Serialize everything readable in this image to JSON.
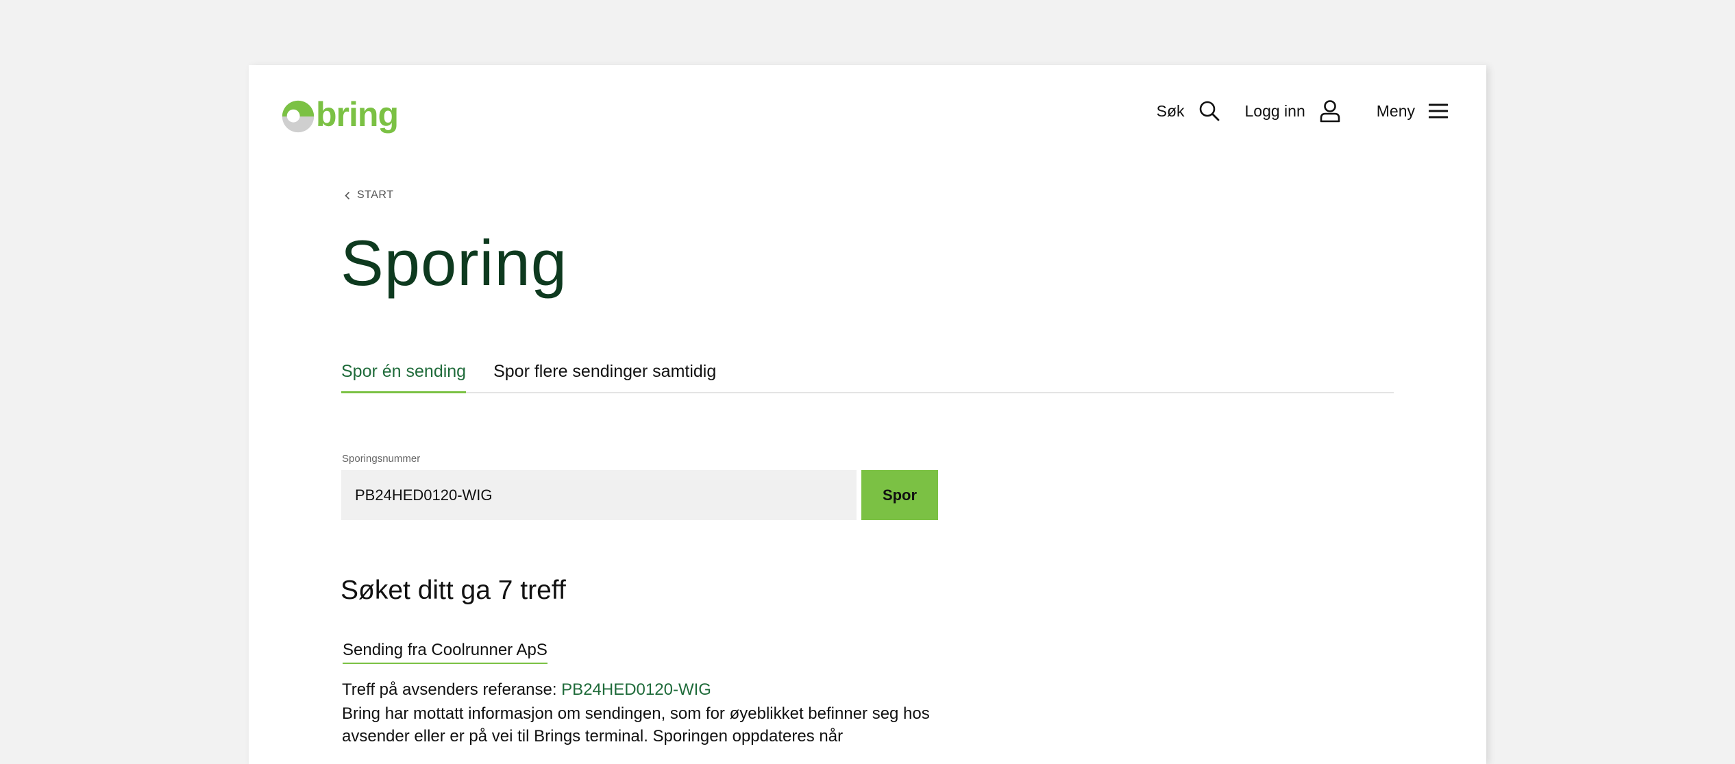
{
  "header": {
    "logo_text": "bring",
    "nav": {
      "search_label": "Søk",
      "login_label": "Logg inn",
      "menu_label": "Meny"
    }
  },
  "breadcrumb": {
    "label": "START"
  },
  "page": {
    "title": "Sporing"
  },
  "tabs": [
    {
      "label": "Spor én sending",
      "active": true
    },
    {
      "label": "Spor flere sendinger samtidig",
      "active": false
    }
  ],
  "search": {
    "label": "Sporingsnummer",
    "value": "PB24HED0120-WIG",
    "button_label": "Spor"
  },
  "results": {
    "heading": "Søket ditt ga 7 treff",
    "items": [
      {
        "title": "Sending fra Coolrunner ApS",
        "ref_prefix": "Treff på avsenders referanse: ",
        "ref_value": "PB24HED0120-WIG",
        "description": "Bring har mottatt informasjon om sendingen, som for øyeblikket befinner seg hos avsender eller er på vei til Brings terminal. Sporingen oppdateres når"
      }
    ]
  },
  "colors": {
    "brand_green": "#7bc144",
    "dark_green": "#0e3a1f",
    "link_green": "#1f6b3a",
    "page_bg": "#f2f2f2"
  },
  "icons": {
    "search": "search-icon",
    "login": "user-icon",
    "menu": "hamburger-menu-icon",
    "breadcrumb": "chevron-left-icon"
  }
}
